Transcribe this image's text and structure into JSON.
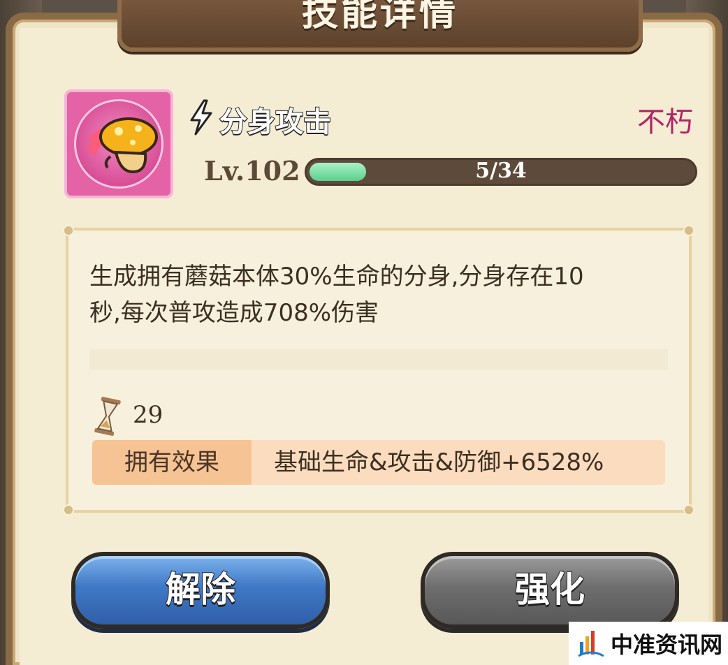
{
  "header": {
    "title": "技能详情"
  },
  "skill": {
    "icon": "mushroom-clone-icon",
    "type_icon": "lightning-bolt-icon",
    "name": "分身攻击",
    "rarity": "不朽",
    "rarity_color": "#b02468",
    "level": "Lv.102",
    "progress": {
      "text": "5/34",
      "current": 5,
      "max": 34
    }
  },
  "description": {
    "lines": [
      "生成拥有蘑菇本体30%生命的分身,分身存在10",
      "秒,每次普攻造成708%伤害"
    ],
    "duration_icon": "hourglass-icon",
    "duration": "29"
  },
  "effect": {
    "label": "拥有效果",
    "value": "基础生命&攻击&防御+6528%"
  },
  "buttons": {
    "release": "解除",
    "enhance": "强化"
  },
  "watermark": {
    "text": "中准资讯网"
  }
}
